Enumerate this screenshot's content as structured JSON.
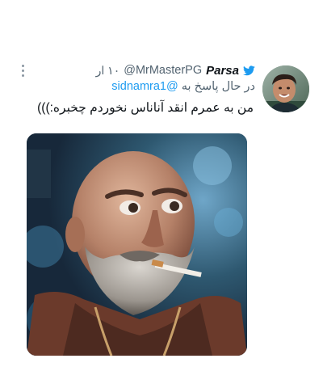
{
  "tweet": {
    "display_name": "Parsa",
    "handle": "@MrMasterPG",
    "time_ago": "۱۰ ار",
    "reply_prefix": "در حال پاسخ به",
    "reply_mention": "@sidnamra1",
    "text": "من به عمرم انقد آناناس نخوردم چخبره:)))",
    "media_icon": "photo-of-bald-bearded-man-with-cigarette",
    "avatar_icon": "profile-photo-smiling-young-man"
  },
  "colors": {
    "background": "#ffffff",
    "text_primary": "#0f1419",
    "text_secondary": "#536471",
    "accent": "#1d9bf0"
  }
}
